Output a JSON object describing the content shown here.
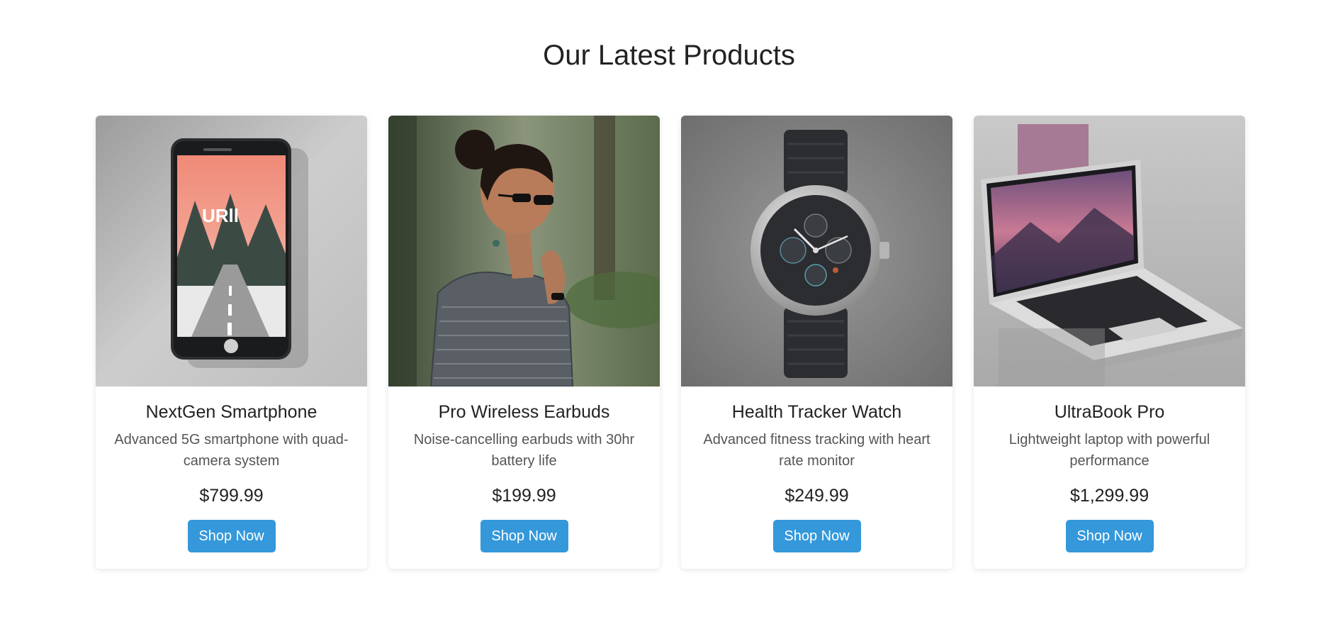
{
  "page": {
    "title": "Our Latest Products"
  },
  "colors": {
    "accent": "#3498db",
    "text": "#222222",
    "muted": "#555555"
  },
  "products": [
    {
      "name": "NextGen Smartphone",
      "description": "Advanced 5G smartphone with quad-camera system",
      "price": "$799.99",
      "button": "Shop Now",
      "screen_text": "URll",
      "image": "smartphone-image"
    },
    {
      "name": "Pro Wireless Earbuds",
      "description": "Noise-cancelling earbuds with 30hr battery life",
      "price": "$199.99",
      "button": "Shop Now",
      "image": "earbuds-model-image"
    },
    {
      "name": "Health Tracker Watch",
      "description": "Advanced fitness tracking with heart rate monitor",
      "price": "$249.99",
      "button": "Shop Now",
      "image": "watch-image"
    },
    {
      "name": "UltraBook Pro",
      "description": "Lightweight laptop with powerful performance",
      "price": "$1,299.99",
      "button": "Shop Now",
      "image": "laptop-image"
    }
  ]
}
